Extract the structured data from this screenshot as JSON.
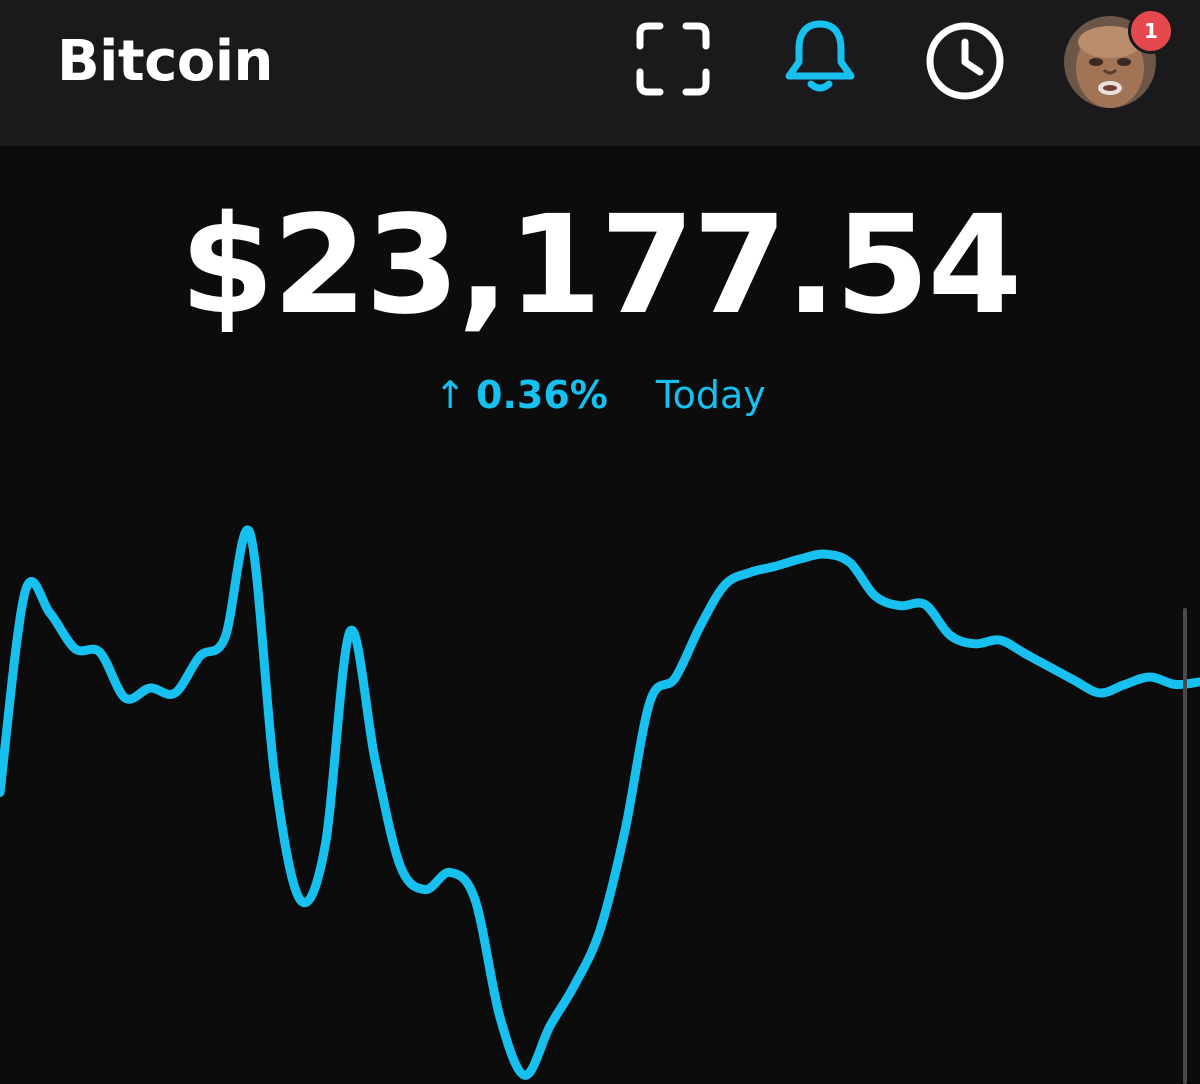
{
  "header": {
    "title": "Bitcoin",
    "icons": {
      "scan": "scan-icon",
      "notifications": "bell-icon",
      "activity": "clock-icon",
      "profile": "avatar"
    },
    "notification_badge_count": "1"
  },
  "price": {
    "value": "$23,177.54",
    "change_arrow": "↑",
    "change_percent": "0.36%",
    "period": "Today"
  },
  "colors": {
    "accent": "#18c0f0",
    "background": "#0c0c0d",
    "header_background": "#1a1a1c",
    "badge": "#e5484d"
  },
  "chart_data": {
    "type": "line",
    "title": "",
    "xlabel": "",
    "ylabel": "",
    "grid": false,
    "legend": "none",
    "x": [
      0,
      1,
      2,
      3,
      4,
      5,
      6,
      7,
      8,
      9,
      10,
      11,
      12,
      13,
      14,
      15,
      16,
      17,
      18,
      19,
      20,
      21,
      22,
      23,
      24,
      25,
      26,
      27,
      28,
      29,
      30,
      31,
      32,
      33,
      34,
      35,
      36,
      37,
      38,
      39,
      40,
      41,
      42,
      43,
      44,
      45,
      46,
      47,
      48
    ],
    "y": [
      11.2,
      27.5,
      25.8,
      22.9,
      22.6,
      18.9,
      19.7,
      19.3,
      22.3,
      23.8,
      32.3,
      12.4,
      2.5,
      6.8,
      24.3,
      13.9,
      5.3,
      3.3,
      4.7,
      2.5,
      -7.1,
      -11.8,
      -7.8,
      -4.4,
      0,
      8.1,
      18.6,
      20.5,
      24.7,
      28.1,
      29.1,
      29.6,
      30.2,
      30.6,
      29.9,
      27.2,
      26.4,
      26.5,
      24.0,
      23.3,
      23.6,
      22.5,
      21.4,
      20.3,
      19.3,
      20.0,
      20.6,
      20.0,
      20.2
    ],
    "ylim": [
      -13,
      35
    ]
  }
}
